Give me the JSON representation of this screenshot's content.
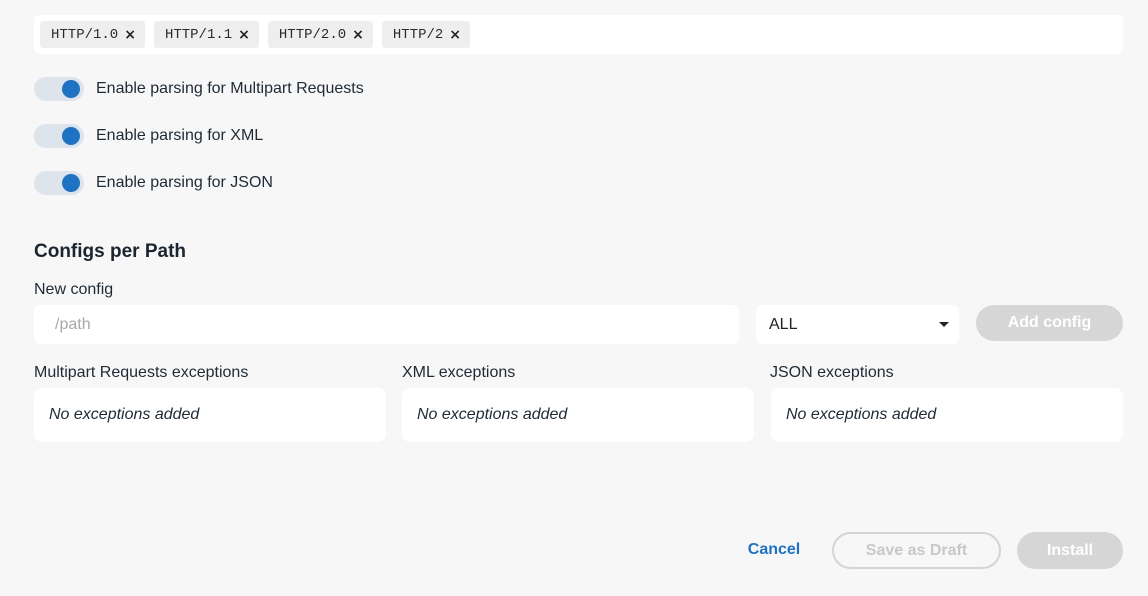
{
  "protocols": {
    "tags": [
      "HTTP/1.0",
      "HTTP/1.1",
      "HTTP/2.0",
      "HTTP/2"
    ],
    "remove_glyph": "×"
  },
  "toggles": [
    {
      "label": "Enable parsing for Multipart Requests",
      "on": true
    },
    {
      "label": "Enable parsing for XML",
      "on": true
    },
    {
      "label": "Enable parsing for JSON",
      "on": true
    }
  ],
  "configs": {
    "title": "Configs per Path",
    "new_config_label": "New config",
    "path_placeholder": "/path",
    "method_value": "ALL",
    "add_button": "Add config",
    "exceptions": [
      {
        "label": "Multipart Requests exceptions",
        "empty_text": "No exceptions added"
      },
      {
        "label": "XML exceptions",
        "empty_text": "No exceptions added"
      },
      {
        "label": "JSON exceptions",
        "empty_text": "No exceptions added"
      }
    ]
  },
  "footer": {
    "cancel": "Cancel",
    "save_draft": "Save as Draft",
    "install": "Install"
  },
  "colors": {
    "accent": "#1f72c2",
    "disabled": "#d6d6d6",
    "background": "#f7f7f7"
  }
}
